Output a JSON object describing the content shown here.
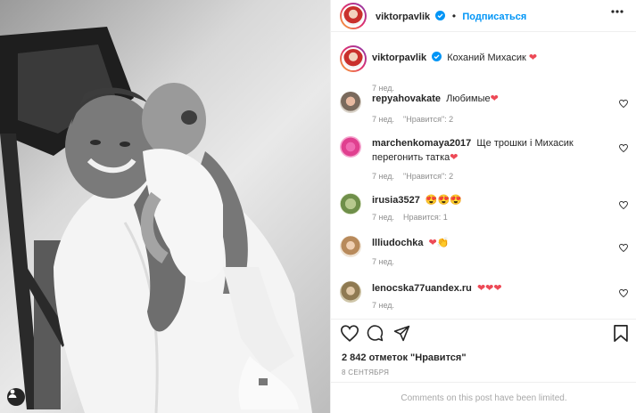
{
  "post": {
    "author": "viktorpavlik",
    "verified": true,
    "follow_label": "Подписаться",
    "dot": "•",
    "caption": "Коханий Михасик",
    "caption_emoji": "❤",
    "caption_time": "7 нед."
  },
  "comments": [
    {
      "user": "repyahovakate",
      "text": "Любимые",
      "emoji": "❤",
      "time": "7 нед.",
      "likes_label": "\"Нравится\": 2"
    },
    {
      "user": "marchenkomaya2017",
      "text": "Ще трошки і Михасик перегонить татка",
      "emoji": "❤",
      "time": "7 нед.",
      "likes_label": "\"Нравится\": 2"
    },
    {
      "user": "irusia3527",
      "text": "",
      "emoji": "😍😍😍",
      "time": "7 нед.",
      "likes_label": "Нравится: 1"
    },
    {
      "user": "llliudochka",
      "text": "",
      "emoji": "❤👏",
      "time": "7 нед.",
      "likes_label": ""
    },
    {
      "user": "lenocska77uandex.ru",
      "text": "",
      "emoji": "❤❤❤",
      "time": "7 нед.",
      "likes_label": ""
    }
  ],
  "stats": {
    "likes": "2 842 отметок \"Нравится\"",
    "date": "8 СЕНТЯБРЯ",
    "limited": "Comments on this post have been limited."
  },
  "colors": {
    "accent": "#0095f6",
    "heart": "#ed4956",
    "muted": "#8e8e8e"
  },
  "icons": [
    "verified-icon",
    "more-icon",
    "heart-outline-icon",
    "comment-icon",
    "share-icon",
    "bookmark-icon",
    "user-tag-icon"
  ]
}
